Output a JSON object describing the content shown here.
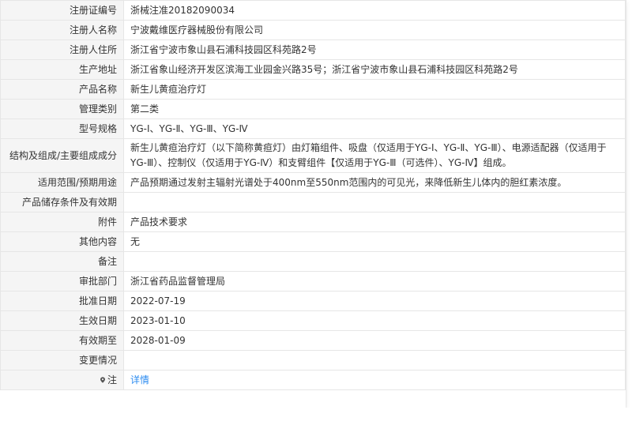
{
  "rows": [
    {
      "label": "注册证编号",
      "value": "浙械注准20182090034"
    },
    {
      "label": "注册人名称",
      "value": "宁波戴维医疗器械股份有限公司"
    },
    {
      "label": "注册人住所",
      "value": "浙江省宁波市象山县石浦科技园区科苑路2号"
    },
    {
      "label": "生产地址",
      "value": "浙江省象山经济开发区滨海工业园金兴路35号；浙江省宁波市象山县石浦科技园区科苑路2号"
    },
    {
      "label": "产品名称",
      "value": "新生儿黄疸治疗灯"
    },
    {
      "label": "管理类别",
      "value": "第二类"
    },
    {
      "label": "型号规格",
      "value": "YG-Ⅰ、YG-Ⅱ、YG-Ⅲ、YG-Ⅳ"
    },
    {
      "label": "结构及组成/主要组成成分",
      "value": "新生儿黄疸治疗灯（以下简称黄疸灯）由灯箱组件、吸盘（仅适用于YG-Ⅰ、YG-Ⅱ、YG-Ⅲ）、电源适配器（仅适用于YG-Ⅲ）、控制仪（仅适用于YG-Ⅳ）和支臂组件【仅适用于YG-Ⅲ（可选件）、YG-Ⅳ】组成。"
    },
    {
      "label": "适用范围/预期用途",
      "value": "产品预期通过发射主辐射光谱处于400nm至550nm范围内的可见光，来降低新生儿体内的胆红素浓度。"
    },
    {
      "label": "产品储存条件及有效期",
      "value": ""
    },
    {
      "label": "附件",
      "value": "产品技术要求"
    },
    {
      "label": "其他内容",
      "value": "无"
    },
    {
      "label": "备注",
      "value": ""
    },
    {
      "label": "审批部门",
      "value": "浙江省药品监督管理局"
    },
    {
      "label": "批准日期",
      "value": "2022-07-19"
    },
    {
      "label": "生效日期",
      "value": "2023-01-10"
    },
    {
      "label": "有效期至",
      "value": "2028-01-09"
    },
    {
      "label": "变更情况",
      "value": ""
    }
  ],
  "note": {
    "label": "注",
    "icon": "map-pin-icon",
    "link_text": "详情",
    "link_color": "#2d8cf0"
  }
}
